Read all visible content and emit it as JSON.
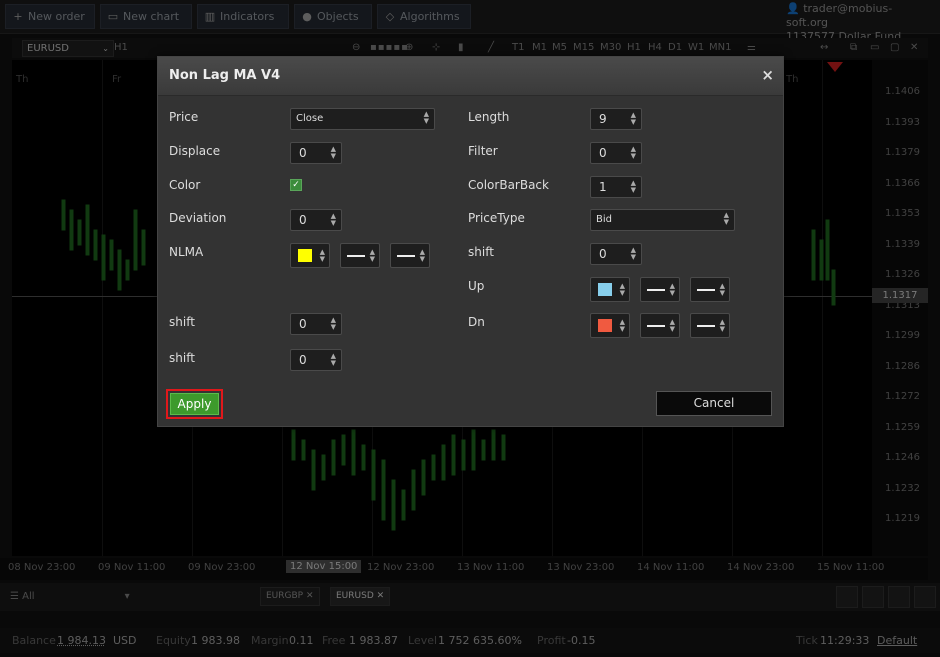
{
  "topbar": {
    "new_order": "New order",
    "new_chart": "New chart",
    "indicators": "Indicators",
    "objects": "Objects",
    "algorithms": "Algorithms",
    "account_email": "trader@mobius-soft.org",
    "account_id": "1137577",
    "account_name": "Dollar Fund"
  },
  "chart_toolbar": {
    "symbol": "EURUSD",
    "timeframe": "H1",
    "periods": [
      "T1",
      "M1",
      "M5",
      "M15",
      "M30",
      "H1",
      "H4",
      "D1",
      "W1",
      "MN1"
    ]
  },
  "chart": {
    "price_labels": [
      "1.1406",
      "1.1393",
      "1.1379",
      "1.1366",
      "1.1353",
      "1.1339",
      "1.1326",
      "1.1313",
      "1.1299",
      "1.1286",
      "1.1272",
      "1.1259",
      "1.1246",
      "1.1232",
      "1.1219"
    ],
    "current_price": "1.1317",
    "time_labels": [
      "08 Nov 23:00",
      "09 Nov 11:00",
      "09 Nov 23:00",
      "12 Nov 15:00",
      "12 Nov 23:00",
      "13 Nov 11:00",
      "13 Nov 23:00",
      "14 Nov 11:00",
      "14 Nov 23:00",
      "15 Nov 11:00"
    ],
    "day_labels": [
      "Th",
      "Fr",
      "Th"
    ]
  },
  "tabs": {
    "filter": "All",
    "symbols": [
      "EURGBP",
      "EURUSD"
    ]
  },
  "status": {
    "balance_label": "Balance",
    "balance": "1 984.13",
    "currency": "USD",
    "equity_label": "Equity",
    "equity": "1 983.98",
    "margin_label": "Margin",
    "margin": "0.11",
    "free_label": "Free",
    "free": "1 983.87",
    "level_label": "Level",
    "level": "1 752 635.60%",
    "profit_label": "Profit",
    "profit": "-0.15",
    "tick_label": "Tick",
    "tick": "11:29:33",
    "default": "Default"
  },
  "dialog": {
    "title": "Non Lag MA V4",
    "close": "×",
    "price_label": "Price",
    "price_value": "Close",
    "displace_label": "Displace",
    "displace_value": "0",
    "color_label": "Color",
    "deviation_label": "Deviation",
    "deviation_value": "0",
    "nlma_label": "NLMA",
    "nlma_color": "#ffff00",
    "shift1_label": "shift",
    "shift1_value": "0",
    "shift2_label": "shift",
    "shift2_value": "0",
    "length_label": "Length",
    "length_value": "9",
    "filter_label": "Filter",
    "filter_value": "0",
    "colorbarback_label": "ColorBarBack",
    "colorbarback_value": "1",
    "pricetype_label": "PriceType",
    "pricetype_value": "Bid",
    "shift3_label": "shift",
    "shift3_value": "0",
    "up_label": "Up",
    "up_color": "#87ceeb",
    "dn_label": "Dn",
    "dn_color": "#f05a40",
    "apply": "Apply",
    "cancel": "Cancel"
  }
}
